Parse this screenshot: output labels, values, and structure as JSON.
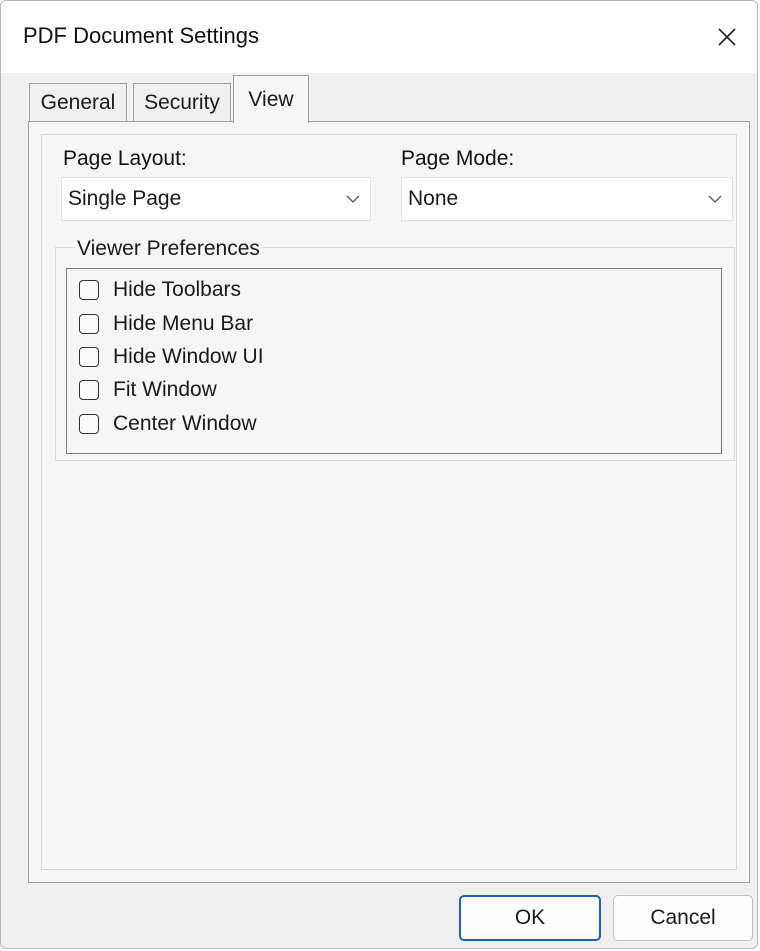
{
  "window": {
    "title": "PDF Document Settings",
    "close_icon": "close-icon"
  },
  "tabs": [
    {
      "label": "General",
      "active": false
    },
    {
      "label": "Security",
      "active": false
    },
    {
      "label": "View",
      "active": true
    }
  ],
  "view": {
    "page_layout": {
      "label": "Page Layout:",
      "value": "Single Page"
    },
    "page_mode": {
      "label": "Page Mode:",
      "value": "None"
    },
    "viewer_preferences": {
      "title": "Viewer Preferences",
      "items": [
        {
          "label": "Hide Toolbars",
          "checked": false
        },
        {
          "label": "Hide Menu Bar",
          "checked": false
        },
        {
          "label": "Hide Window UI",
          "checked": false
        },
        {
          "label": "Fit Window",
          "checked": false
        },
        {
          "label": "Center Window",
          "checked": false
        }
      ]
    }
  },
  "buttons": {
    "ok": "OK",
    "cancel": "Cancel"
  },
  "colors": {
    "accent": "#1f5fb5",
    "dialog_bg": "#f0f0f0",
    "panel_bg": "#f6f6f6"
  }
}
